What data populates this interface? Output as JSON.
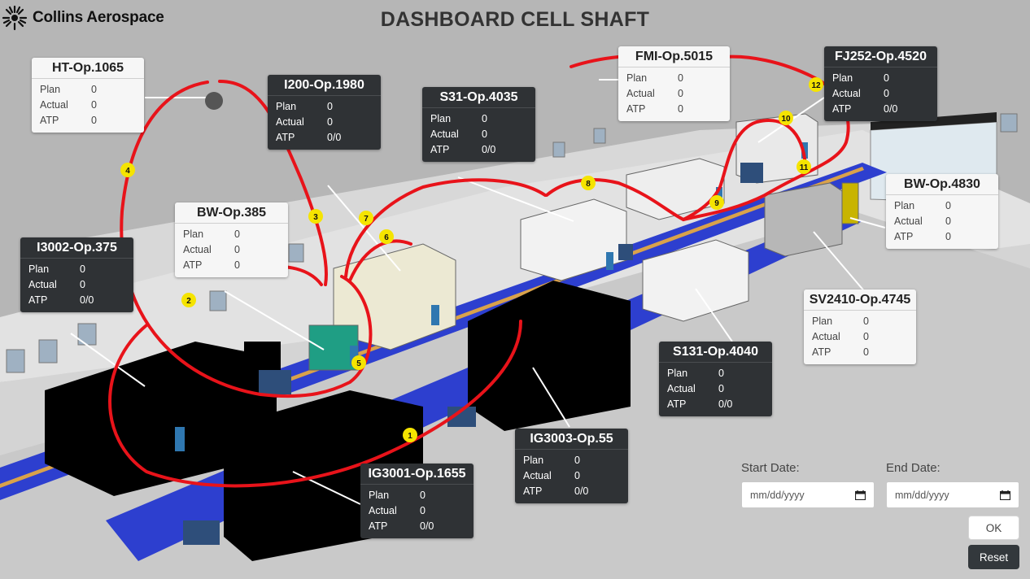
{
  "header": {
    "logo_text": "Collins Aerospace",
    "title": "DASHBOARD CELL SHAFT"
  },
  "labels": {
    "plan": "Plan",
    "actual": "Actual",
    "atp": "ATP"
  },
  "stations": [
    {
      "name": "HT-Op.1065",
      "theme": "light",
      "plan": "0",
      "actual": "0",
      "atp": "0"
    },
    {
      "name": "I200-Op.1980",
      "theme": "dark",
      "plan": "0",
      "actual": "0",
      "atp": "0/0"
    },
    {
      "name": "S31-Op.4035",
      "theme": "dark",
      "plan": "0",
      "actual": "0",
      "atp": "0/0"
    },
    {
      "name": "FMI-Op.5015",
      "theme": "light",
      "plan": "0",
      "actual": "0",
      "atp": "0"
    },
    {
      "name": "FJ252-Op.4520",
      "theme": "dark",
      "plan": "0",
      "actual": "0",
      "atp": "0/0"
    },
    {
      "name": "BW-Op.385",
      "theme": "light",
      "plan": "0",
      "actual": "0",
      "atp": "0"
    },
    {
      "name": "I3002-Op.375",
      "theme": "dark",
      "plan": "0",
      "actual": "0",
      "atp": "0/0"
    },
    {
      "name": "BW-Op.4830",
      "theme": "light",
      "plan": "0",
      "actual": "0",
      "atp": "0"
    },
    {
      "name": "SV2410-Op.4745",
      "theme": "light",
      "plan": "0",
      "actual": "0",
      "atp": "0"
    },
    {
      "name": "S131-Op.4040",
      "theme": "dark",
      "plan": "0",
      "actual": "0",
      "atp": "0/0"
    },
    {
      "name": "IG3003-Op.55",
      "theme": "dark",
      "plan": "0",
      "actual": "0",
      "atp": "0/0"
    },
    {
      "name": "IG3001-Op.1655",
      "theme": "dark",
      "plan": "0",
      "actual": "0",
      "atp": "0/0"
    }
  ],
  "route_markers": [
    "1",
    "2",
    "3",
    "4",
    "5",
    "6",
    "7",
    "8",
    "9",
    "10",
    "11",
    "12"
  ],
  "filters": {
    "start_label": "Start Date:",
    "end_label": "End Date:",
    "start_placeholder": "mm/dd/yyyy",
    "end_placeholder": "mm/dd/yyyy",
    "ok_label": "OK",
    "reset_label": "Reset"
  },
  "colors": {
    "route": "#e8131a",
    "marker": "#f5e400",
    "conveyor": "#2d3fcf",
    "dark_card": "#2f3235"
  }
}
